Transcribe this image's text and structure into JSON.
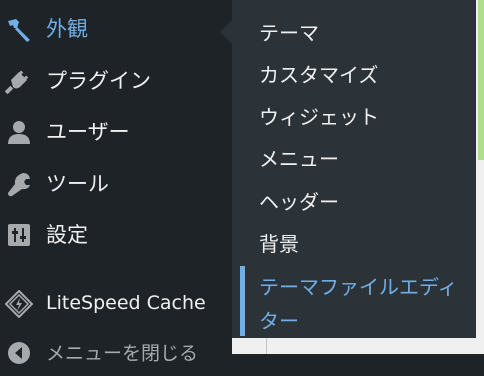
{
  "sidebar": {
    "items": [
      {
        "label": "外観",
        "icon": "paintbrush-icon",
        "current": true
      },
      {
        "label": "プラグイン",
        "icon": "plugin-icon"
      },
      {
        "label": "ユーザー",
        "icon": "user-icon"
      },
      {
        "label": "ツール",
        "icon": "wrench-icon"
      },
      {
        "label": "設定",
        "icon": "settings-sliders-icon"
      },
      {
        "label": "LiteSpeed Cache",
        "icon": "litespeed-diamond-icon"
      },
      {
        "label": "メニューを閉じる",
        "icon": "collapse-arrow-icon"
      }
    ]
  },
  "submenu": {
    "items": [
      {
        "label": "テーマ"
      },
      {
        "label": "カスタマイズ"
      },
      {
        "label": "ウィジェット"
      },
      {
        "label": "メニュー"
      },
      {
        "label": "ヘッダー"
      },
      {
        "label": "背景"
      },
      {
        "label": "テーマファイルエディター",
        "active": true
      }
    ]
  },
  "colors": {
    "sidebar_bg": "#1d2327",
    "submenu_bg": "#2c3338",
    "accent_blue": "#72aee6",
    "text": "#f0f0f1",
    "icon": "#a7aaad"
  }
}
